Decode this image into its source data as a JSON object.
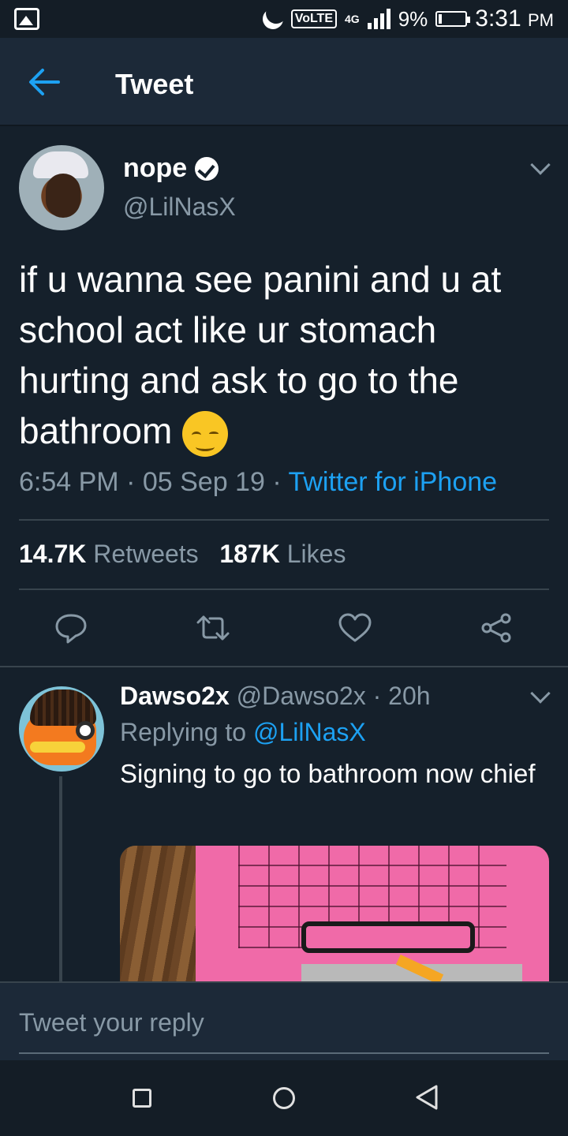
{
  "status_bar": {
    "network_label": "VoLTE",
    "network_type": "4G",
    "battery": "9%",
    "time": "3:31",
    "ampm": "PM"
  },
  "header": {
    "title": "Tweet"
  },
  "tweet": {
    "display_name": "nope",
    "handle": "@LilNasX",
    "text": "if u wanna see panini and u at school act like ur stomach hurting and ask to go to the bathroom",
    "time": "6:54 PM",
    "date": "05 Sep 19",
    "source": "Twitter for iPhone",
    "retweets_count": "14.7K",
    "retweets_label": "Retweets",
    "likes_count": "187K",
    "likes_label": "Likes",
    "emoji": "relieved-face"
  },
  "reply": {
    "display_name": "Dawso2x",
    "handle": "@Dawso2x",
    "age": "20h",
    "replying_prefix": "Replying to",
    "replying_to": "@LilNasX",
    "text": "Signing to go to bathroom now chief"
  },
  "reply_bar": {
    "placeholder": "Tweet your reply"
  },
  "colors": {
    "background": "#15202b",
    "accent": "#1da1f2",
    "secondary_text": "#8899a6"
  }
}
